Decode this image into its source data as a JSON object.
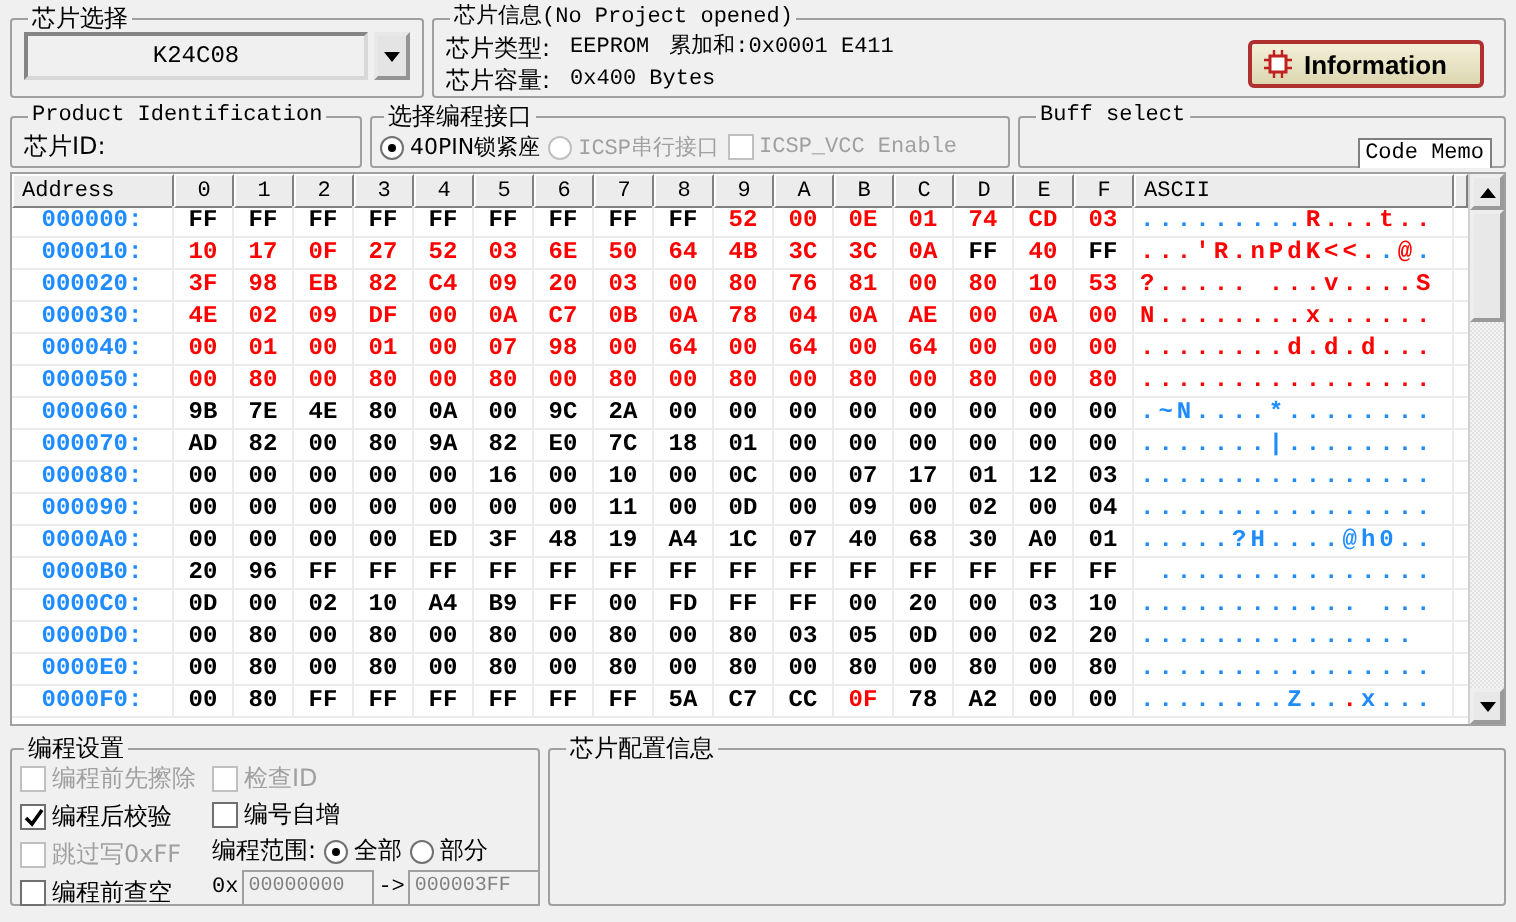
{
  "chip_select": {
    "title": "芯片选择",
    "value": "K24C08"
  },
  "chip_info": {
    "title": "芯片信息(No Project opened)",
    "type_label": "芯片类型:",
    "type_value": "EEPROM",
    "checksum": "累加和:0x0001 E411",
    "capacity_label": "芯片容量:",
    "capacity_value": "0x400 Bytes",
    "button": "Information"
  },
  "product_id": {
    "title": "Product Identification",
    "label": "芯片ID:"
  },
  "interface": {
    "title": "选择编程接口",
    "options": [
      {
        "kind": "radio",
        "label": "40PIN锁紧座",
        "selected": true,
        "disabled": false
      },
      {
        "kind": "radio",
        "label": "ICSP串行接口",
        "selected": false,
        "disabled": true
      },
      {
        "kind": "checkbox",
        "label": "ICSP_VCC Enable",
        "checked": false,
        "disabled": true
      }
    ]
  },
  "buff_select": {
    "title": "Buff select",
    "tab": "Code Memo"
  },
  "hex_view": {
    "columns": [
      "Address",
      "0",
      "1",
      "2",
      "3",
      "4",
      "5",
      "6",
      "7",
      "8",
      "9",
      "A",
      "B",
      "C",
      "D",
      "E",
      "F",
      "ASCII"
    ],
    "rows": [
      {
        "address": "000000:",
        "ascii": ".........R...t..",
        "bytes": [
          {
            "v": "FF",
            "modified": false
          },
          {
            "v": "FF",
            "modified": false
          },
          {
            "v": "FF",
            "modified": false
          },
          {
            "v": "FF",
            "modified": false
          },
          {
            "v": "FF",
            "modified": false
          },
          {
            "v": "FF",
            "modified": false
          },
          {
            "v": "FF",
            "modified": false
          },
          {
            "v": "FF",
            "modified": false
          },
          {
            "v": "FF",
            "modified": false
          },
          {
            "v": "52",
            "modified": true
          },
          {
            "v": "00",
            "modified": true
          },
          {
            "v": "0E",
            "modified": true
          },
          {
            "v": "01",
            "modified": true
          },
          {
            "v": "74",
            "modified": true
          },
          {
            "v": "CD",
            "modified": true
          },
          {
            "v": "03",
            "modified": true
          }
        ]
      },
      {
        "address": "000010:",
        "ascii": "...'R.nPdK<<..@.",
        "bytes": [
          {
            "v": "10",
            "modified": true
          },
          {
            "v": "17",
            "modified": true
          },
          {
            "v": "0F",
            "modified": true
          },
          {
            "v": "27",
            "modified": true
          },
          {
            "v": "52",
            "modified": true
          },
          {
            "v": "03",
            "modified": true
          },
          {
            "v": "6E",
            "modified": true
          },
          {
            "v": "50",
            "modified": true
          },
          {
            "v": "64",
            "modified": true
          },
          {
            "v": "4B",
            "modified": true
          },
          {
            "v": "3C",
            "modified": true
          },
          {
            "v": "3C",
            "modified": true
          },
          {
            "v": "0A",
            "modified": true
          },
          {
            "v": "FF",
            "modified": false
          },
          {
            "v": "40",
            "modified": true
          },
          {
            "v": "FF",
            "modified": false
          }
        ]
      },
      {
        "address": "000020:",
        "ascii": "?..... ...v....S",
        "bytes": [
          {
            "v": "3F",
            "modified": true
          },
          {
            "v": "98",
            "modified": true
          },
          {
            "v": "EB",
            "modified": true
          },
          {
            "v": "82",
            "modified": true
          },
          {
            "v": "C4",
            "modified": true
          },
          {
            "v": "09",
            "modified": true
          },
          {
            "v": "20",
            "modified": true
          },
          {
            "v": "03",
            "modified": true
          },
          {
            "v": "00",
            "modified": true
          },
          {
            "v": "80",
            "modified": true
          },
          {
            "v": "76",
            "modified": true
          },
          {
            "v": "81",
            "modified": true
          },
          {
            "v": "00",
            "modified": true
          },
          {
            "v": "80",
            "modified": true
          },
          {
            "v": "10",
            "modified": true
          },
          {
            "v": "53",
            "modified": true
          }
        ]
      },
      {
        "address": "000030:",
        "ascii": "N........x......",
        "bytes": [
          {
            "v": "4E",
            "modified": true
          },
          {
            "v": "02",
            "modified": true
          },
          {
            "v": "09",
            "modified": true
          },
          {
            "v": "DF",
            "modified": true
          },
          {
            "v": "00",
            "modified": true
          },
          {
            "v": "0A",
            "modified": true
          },
          {
            "v": "C7",
            "modified": true
          },
          {
            "v": "0B",
            "modified": true
          },
          {
            "v": "0A",
            "modified": true
          },
          {
            "v": "78",
            "modified": true
          },
          {
            "v": "04",
            "modified": true
          },
          {
            "v": "0A",
            "modified": true
          },
          {
            "v": "AE",
            "modified": true
          },
          {
            "v": "00",
            "modified": true
          },
          {
            "v": "0A",
            "modified": true
          },
          {
            "v": "00",
            "modified": true
          }
        ]
      },
      {
        "address": "000040:",
        "ascii": "........d.d.d...",
        "bytes": [
          {
            "v": "00",
            "modified": true
          },
          {
            "v": "01",
            "modified": true
          },
          {
            "v": "00",
            "modified": true
          },
          {
            "v": "01",
            "modified": true
          },
          {
            "v": "00",
            "modified": true
          },
          {
            "v": "07",
            "modified": true
          },
          {
            "v": "98",
            "modified": true
          },
          {
            "v": "00",
            "modified": true
          },
          {
            "v": "64",
            "modified": true
          },
          {
            "v": "00",
            "modified": true
          },
          {
            "v": "64",
            "modified": true
          },
          {
            "v": "00",
            "modified": true
          },
          {
            "v": "64",
            "modified": true
          },
          {
            "v": "00",
            "modified": true
          },
          {
            "v": "00",
            "modified": true
          },
          {
            "v": "00",
            "modified": true
          }
        ]
      },
      {
        "address": "000050:",
        "ascii": "................",
        "bytes": [
          {
            "v": "00",
            "modified": true
          },
          {
            "v": "80",
            "modified": true
          },
          {
            "v": "00",
            "modified": true
          },
          {
            "v": "80",
            "modified": true
          },
          {
            "v": "00",
            "modified": true
          },
          {
            "v": "80",
            "modified": true
          },
          {
            "v": "00",
            "modified": true
          },
          {
            "v": "80",
            "modified": true
          },
          {
            "v": "00",
            "modified": true
          },
          {
            "v": "80",
            "modified": true
          },
          {
            "v": "00",
            "modified": true
          },
          {
            "v": "80",
            "modified": true
          },
          {
            "v": "00",
            "modified": true
          },
          {
            "v": "80",
            "modified": true
          },
          {
            "v": "00",
            "modified": true
          },
          {
            "v": "80",
            "modified": true
          }
        ]
      },
      {
        "address": "000060:",
        "ascii": ".~N....*........",
        "bytes": [
          {
            "v": "9B",
            "modified": false
          },
          {
            "v": "7E",
            "modified": false
          },
          {
            "v": "4E",
            "modified": false
          },
          {
            "v": "80",
            "modified": false
          },
          {
            "v": "0A",
            "modified": false
          },
          {
            "v": "00",
            "modified": false
          },
          {
            "v": "9C",
            "modified": false
          },
          {
            "v": "2A",
            "modified": false
          },
          {
            "v": "00",
            "modified": false
          },
          {
            "v": "00",
            "modified": false
          },
          {
            "v": "00",
            "modified": false
          },
          {
            "v": "00",
            "modified": false
          },
          {
            "v": "00",
            "modified": false
          },
          {
            "v": "00",
            "modified": false
          },
          {
            "v": "00",
            "modified": false
          },
          {
            "v": "00",
            "modified": false
          }
        ]
      },
      {
        "address": "000070:",
        "ascii": ".......|........",
        "bytes": [
          {
            "v": "AD",
            "modified": false
          },
          {
            "v": "82",
            "modified": false
          },
          {
            "v": "00",
            "modified": false
          },
          {
            "v": "80",
            "modified": false
          },
          {
            "v": "9A",
            "modified": false
          },
          {
            "v": "82",
            "modified": false
          },
          {
            "v": "E0",
            "modified": false
          },
          {
            "v": "7C",
            "modified": false
          },
          {
            "v": "18",
            "modified": false
          },
          {
            "v": "01",
            "modified": false
          },
          {
            "v": "00",
            "modified": false
          },
          {
            "v": "00",
            "modified": false
          },
          {
            "v": "00",
            "modified": false
          },
          {
            "v": "00",
            "modified": false
          },
          {
            "v": "00",
            "modified": false
          },
          {
            "v": "00",
            "modified": false
          }
        ]
      },
      {
        "address": "000080:",
        "ascii": "................",
        "bytes": [
          {
            "v": "00",
            "modified": false
          },
          {
            "v": "00",
            "modified": false
          },
          {
            "v": "00",
            "modified": false
          },
          {
            "v": "00",
            "modified": false
          },
          {
            "v": "00",
            "modified": false
          },
          {
            "v": "16",
            "modified": false
          },
          {
            "v": "00",
            "modified": false
          },
          {
            "v": "10",
            "modified": false
          },
          {
            "v": "00",
            "modified": false
          },
          {
            "v": "0C",
            "modified": false
          },
          {
            "v": "00",
            "modified": false
          },
          {
            "v": "07",
            "modified": false
          },
          {
            "v": "17",
            "modified": false
          },
          {
            "v": "01",
            "modified": false
          },
          {
            "v": "12",
            "modified": false
          },
          {
            "v": "03",
            "modified": false
          }
        ]
      },
      {
        "address": "000090:",
        "ascii": "................",
        "bytes": [
          {
            "v": "00",
            "modified": false
          },
          {
            "v": "00",
            "modified": false
          },
          {
            "v": "00",
            "modified": false
          },
          {
            "v": "00",
            "modified": false
          },
          {
            "v": "00",
            "modified": false
          },
          {
            "v": "00",
            "modified": false
          },
          {
            "v": "00",
            "modified": false
          },
          {
            "v": "11",
            "modified": false
          },
          {
            "v": "00",
            "modified": false
          },
          {
            "v": "0D",
            "modified": false
          },
          {
            "v": "00",
            "modified": false
          },
          {
            "v": "09",
            "modified": false
          },
          {
            "v": "00",
            "modified": false
          },
          {
            "v": "02",
            "modified": false
          },
          {
            "v": "00",
            "modified": false
          },
          {
            "v": "04",
            "modified": false
          }
        ]
      },
      {
        "address": "0000A0:",
        "ascii": ".....?H....@h0..",
        "bytes": [
          {
            "v": "00",
            "modified": false
          },
          {
            "v": "00",
            "modified": false
          },
          {
            "v": "00",
            "modified": false
          },
          {
            "v": "00",
            "modified": false
          },
          {
            "v": "ED",
            "modified": false
          },
          {
            "v": "3F",
            "modified": false
          },
          {
            "v": "48",
            "modified": false
          },
          {
            "v": "19",
            "modified": false
          },
          {
            "v": "A4",
            "modified": false
          },
          {
            "v": "1C",
            "modified": false
          },
          {
            "v": "07",
            "modified": false
          },
          {
            "v": "40",
            "modified": false
          },
          {
            "v": "68",
            "modified": false
          },
          {
            "v": "30",
            "modified": false
          },
          {
            "v": "A0",
            "modified": false
          },
          {
            "v": "01",
            "modified": false
          }
        ]
      },
      {
        "address": "0000B0:",
        "ascii": " ...............",
        "bytes": [
          {
            "v": "20",
            "modified": false
          },
          {
            "v": "96",
            "modified": false
          },
          {
            "v": "FF",
            "modified": false
          },
          {
            "v": "FF",
            "modified": false
          },
          {
            "v": "FF",
            "modified": false
          },
          {
            "v": "FF",
            "modified": false
          },
          {
            "v": "FF",
            "modified": false
          },
          {
            "v": "FF",
            "modified": false
          },
          {
            "v": "FF",
            "modified": false
          },
          {
            "v": "FF",
            "modified": false
          },
          {
            "v": "FF",
            "modified": false
          },
          {
            "v": "FF",
            "modified": false
          },
          {
            "v": "FF",
            "modified": false
          },
          {
            "v": "FF",
            "modified": false
          },
          {
            "v": "FF",
            "modified": false
          },
          {
            "v": "FF",
            "modified": false
          }
        ]
      },
      {
        "address": "0000C0:",
        "ascii": "............ ...",
        "bytes": [
          {
            "v": "0D",
            "modified": false
          },
          {
            "v": "00",
            "modified": false
          },
          {
            "v": "02",
            "modified": false
          },
          {
            "v": "10",
            "modified": false
          },
          {
            "v": "A4",
            "modified": false
          },
          {
            "v": "B9",
            "modified": false
          },
          {
            "v": "FF",
            "modified": false
          },
          {
            "v": "00",
            "modified": false
          },
          {
            "v": "FD",
            "modified": false
          },
          {
            "v": "FF",
            "modified": false
          },
          {
            "v": "FF",
            "modified": false
          },
          {
            "v": "00",
            "modified": false
          },
          {
            "v": "20",
            "modified": false
          },
          {
            "v": "00",
            "modified": false
          },
          {
            "v": "03",
            "modified": false
          },
          {
            "v": "10",
            "modified": false
          }
        ]
      },
      {
        "address": "0000D0:",
        "ascii": "............... ",
        "bytes": [
          {
            "v": "00",
            "modified": false
          },
          {
            "v": "80",
            "modified": false
          },
          {
            "v": "00",
            "modified": false
          },
          {
            "v": "80",
            "modified": false
          },
          {
            "v": "00",
            "modified": false
          },
          {
            "v": "80",
            "modified": false
          },
          {
            "v": "00",
            "modified": false
          },
          {
            "v": "80",
            "modified": false
          },
          {
            "v": "00",
            "modified": false
          },
          {
            "v": "80",
            "modified": false
          },
          {
            "v": "03",
            "modified": false
          },
          {
            "v": "05",
            "modified": false
          },
          {
            "v": "0D",
            "modified": false
          },
          {
            "v": "00",
            "modified": false
          },
          {
            "v": "02",
            "modified": false
          },
          {
            "v": "20",
            "modified": false
          }
        ]
      },
      {
        "address": "0000E0:",
        "ascii": "................",
        "bytes": [
          {
            "v": "00",
            "modified": false
          },
          {
            "v": "80",
            "modified": false
          },
          {
            "v": "00",
            "modified": false
          },
          {
            "v": "80",
            "modified": false
          },
          {
            "v": "00",
            "modified": false
          },
          {
            "v": "80",
            "modified": false
          },
          {
            "v": "00",
            "modified": false
          },
          {
            "v": "80",
            "modified": false
          },
          {
            "v": "00",
            "modified": false
          },
          {
            "v": "80",
            "modified": false
          },
          {
            "v": "00",
            "modified": false
          },
          {
            "v": "80",
            "modified": false
          },
          {
            "v": "00",
            "modified": false
          },
          {
            "v": "80",
            "modified": false
          },
          {
            "v": "00",
            "modified": false
          },
          {
            "v": "80",
            "modified": false
          }
        ]
      },
      {
        "address": "0000F0:",
        "ascii": "........Z...x...",
        "bytes": [
          {
            "v": "00",
            "modified": false
          },
          {
            "v": "80",
            "modified": false
          },
          {
            "v": "FF",
            "modified": false
          },
          {
            "v": "FF",
            "modified": false
          },
          {
            "v": "FF",
            "modified": false
          },
          {
            "v": "FF",
            "modified": false
          },
          {
            "v": "FF",
            "modified": false
          },
          {
            "v": "FF",
            "modified": false
          },
          {
            "v": "5A",
            "modified": false
          },
          {
            "v": "C7",
            "modified": false
          },
          {
            "v": "CC",
            "modified": false
          },
          {
            "v": "0F",
            "modified": true
          },
          {
            "v": "78",
            "modified": false
          },
          {
            "v": "A2",
            "modified": false
          },
          {
            "v": "00",
            "modified": false
          },
          {
            "v": "00",
            "modified": false
          }
        ]
      }
    ]
  },
  "program_settings": {
    "title": "编程设置",
    "options_left": [
      {
        "label": "编程前先擦除",
        "checked": false,
        "disabled": true
      },
      {
        "label": "编程后校验",
        "checked": true,
        "disabled": false
      },
      {
        "label": "跳过写0xFF",
        "checked": false,
        "disabled": true
      },
      {
        "label": "编程前查空",
        "checked": false,
        "disabled": false
      }
    ],
    "options_right": [
      {
        "label": "检查ID",
        "checked": false,
        "disabled": true
      },
      {
        "label": "编号自增",
        "checked": false,
        "disabled": false
      }
    ],
    "range_label": "编程范围:",
    "range_options": [
      {
        "label": "全部",
        "selected": true
      },
      {
        "label": "部分",
        "selected": false
      }
    ],
    "prefix": "0x",
    "start": "00000000",
    "arrow": "->",
    "end": "000003FF"
  },
  "config_info": {
    "title": "芯片配置信息"
  }
}
